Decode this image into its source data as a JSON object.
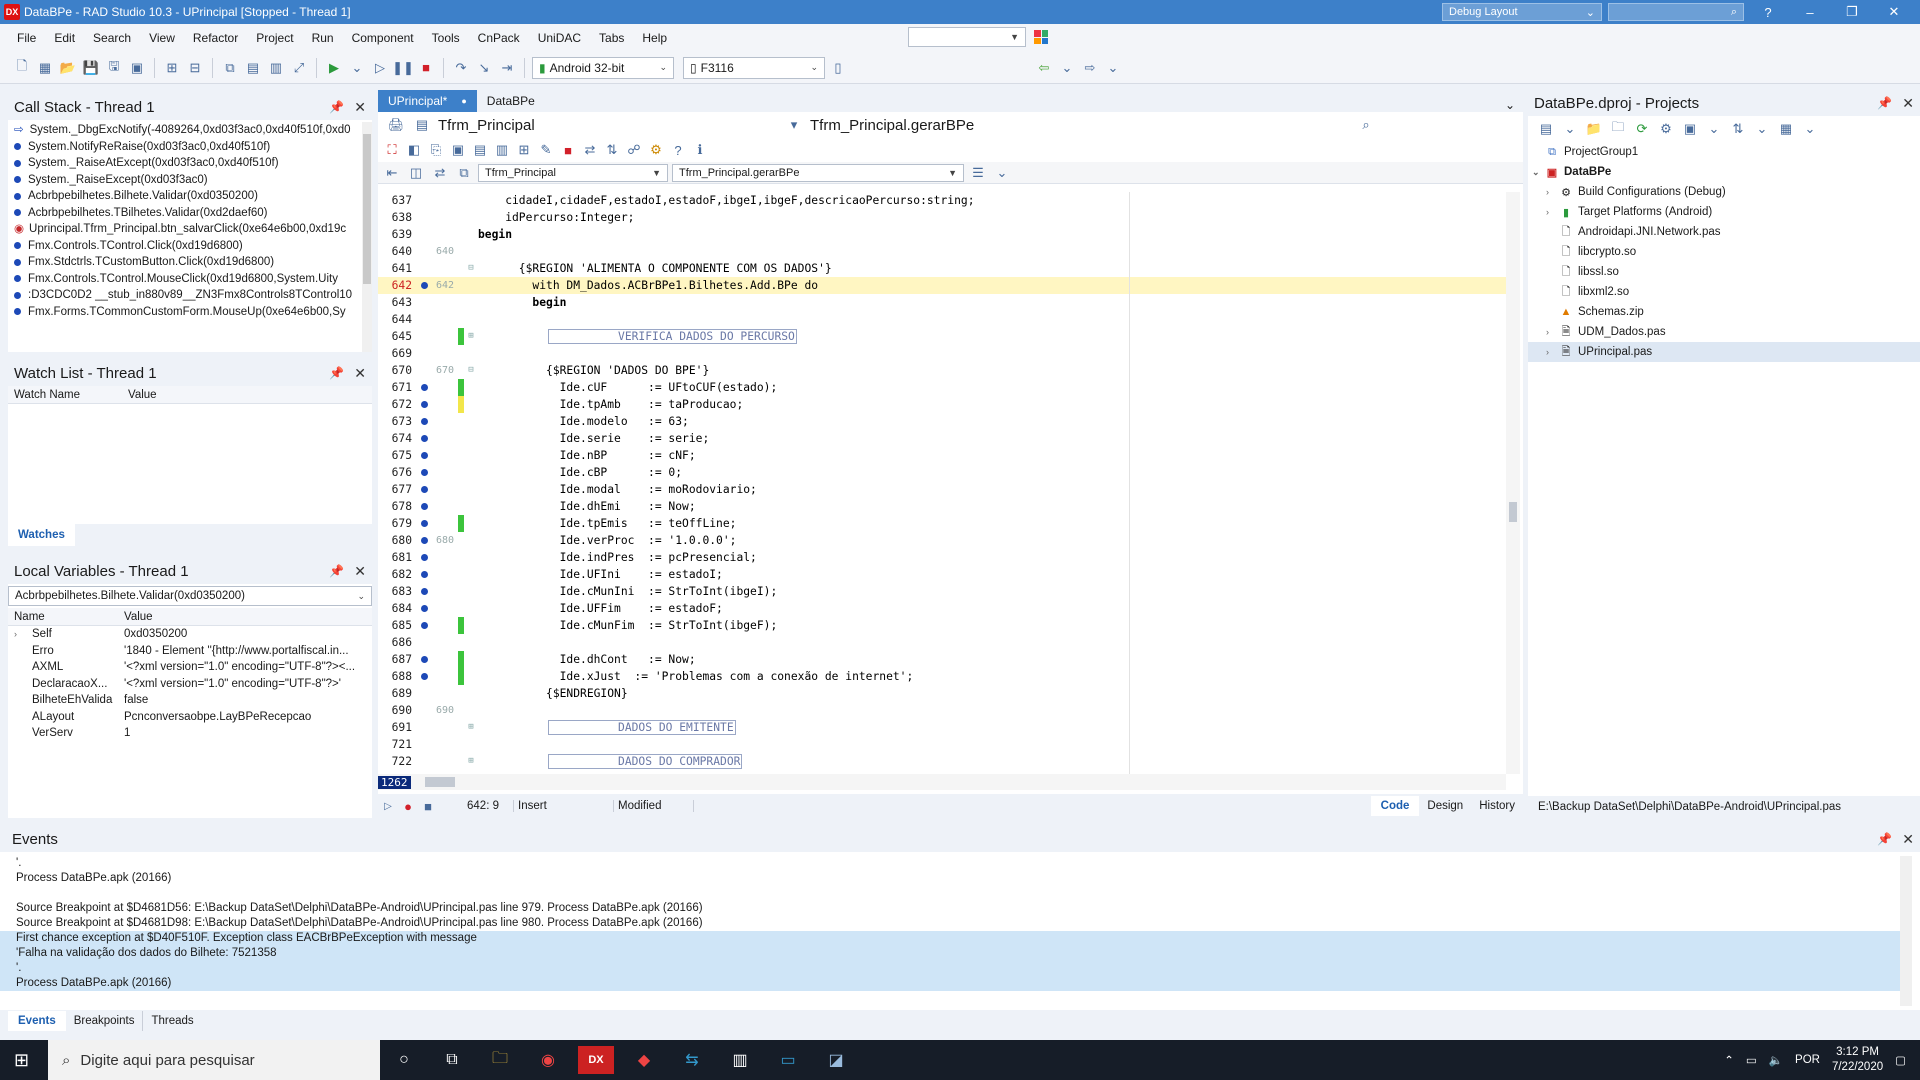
{
  "window": {
    "title": "DataBPe - RAD Studio 10.3 - UPrincipal [Stopped - Thread 1]",
    "layout_combo": "Debug Layout",
    "search_placeholder": ""
  },
  "menu": [
    "File",
    "Edit",
    "Search",
    "View",
    "Refactor",
    "Project",
    "Run",
    "Component",
    "Tools",
    "CnPack",
    "UniDAC",
    "Tabs",
    "Help"
  ],
  "toolbar": {
    "platform": "Android 32-bit",
    "device": "F3116"
  },
  "call_stack": {
    "title": "Call Stack - Thread 1",
    "items": [
      "System._DbgExcNotify(-4089264,0xd03f3ac0,0xd40f510f,0xd0",
      "System.NotifyReRaise(0xd03f3ac0,0xd40f510f)",
      "System._RaiseAtExcept(0xd03f3ac0,0xd40f510f)",
      "System._RaiseExcept(0xd03f3ac0)",
      "Acbrbpebilhetes.Bilhete.Validar(0xd0350200)",
      "Acbrbpebilhetes.TBilhetes.Validar(0xd2daef60)",
      "Uprincipal.Tfrm_Principal.btn_salvarClick(0xe64e6b00,0xd19c",
      "Fmx.Controls.TControl.Click(0xd19d6800)",
      "Fmx.Stdctrls.TCustomButton.Click(0xd19d6800)",
      "Fmx.Controls.TControl.MouseClick(0xd19d6800,System.Uity",
      ":D3CDC0D2 __stub_in880v89__ZN3Fmx8Controls8TControl10",
      "Fmx.Forms.TCommonCustomForm.MouseUp(0xe64e6b00,Sy"
    ]
  },
  "watch_list": {
    "title": "Watch List - Thread 1",
    "col_name": "Watch Name",
    "col_value": "Value",
    "tab": "Watches"
  },
  "locals": {
    "title": "Local Variables - Thread 1",
    "context": "Acbrbpebilhetes.Bilhete.Validar(0xd0350200)",
    "col_name": "Name",
    "col_value": "Value",
    "rows": [
      {
        "name": "Self",
        "value": "0xd0350200"
      },
      {
        "name": "Erro",
        "value": "'1840 - Element ''{http://www.portalfiscal.in..."
      },
      {
        "name": "AXML",
        "value": "'<?xml version=\"1.0\" encoding=\"UTF-8\"?><..."
      },
      {
        "name": "DeclaracaoX...",
        "value": "'<?xml version=\"1.0\" encoding=\"UTF-8\"?>'"
      },
      {
        "name": "BilheteEhValida",
        "value": "false"
      },
      {
        "name": "ALayout",
        "value": "Pcnconversaobpe.LayBPeRecepcao"
      },
      {
        "name": "VerServ",
        "value": "1"
      }
    ]
  },
  "editor": {
    "tabs": [
      "UPrincipal*",
      "DataBPe"
    ],
    "class_combo": "Tfrm_Principal",
    "method_combo": "Tfrm_Principal.gerarBPe",
    "nav_class": "Tfrm_Principal",
    "nav_method": "Tfrm_Principal.gerarBPe",
    "lines": [
      {
        "n": "637",
        "code": "    cidadeI,cidadeF,estadoI,estadoF,ibgeI,ibgeF,descricaoPercurso:string;"
      },
      {
        "n": "638",
        "code": "    idPercurso:Integer;"
      },
      {
        "n": "639",
        "code": "begin"
      },
      {
        "n": "640",
        "code": ""
      },
      {
        "n": "641",
        "code": "      {$REGION 'ALIMENTA O COMPONENTE COM OS DADOS'}"
      },
      {
        "n": "642",
        "code": "        with DM_Dados.ACBrBPe1.Bilhetes.Add.BPe do"
      },
      {
        "n": "643",
        "code": "        begin"
      },
      {
        "n": "644",
        "code": ""
      },
      {
        "n": "645",
        "code": "          VERIFICA DADOS DO PERCURSO"
      },
      {
        "n": "669",
        "code": ""
      },
      {
        "n": "670",
        "code": "          {$REGION 'DADOS DO BPE'}"
      },
      {
        "n": "671",
        "code": "            Ide.cUF      := UFtoCUF(estado);"
      },
      {
        "n": "672",
        "code": "            Ide.tpAmb    := taProducao;"
      },
      {
        "n": "673",
        "code": "            Ide.modelo   := 63;"
      },
      {
        "n": "674",
        "code": "            Ide.serie    := serie;"
      },
      {
        "n": "675",
        "code": "            Ide.nBP      := cNF;"
      },
      {
        "n": "676",
        "code": "            Ide.cBP      := 0;"
      },
      {
        "n": "677",
        "code": "            Ide.modal    := moRodoviario;"
      },
      {
        "n": "678",
        "code": "            Ide.dhEmi    := Now;"
      },
      {
        "n": "679",
        "code": "            Ide.tpEmis   := teOffLine;"
      },
      {
        "n": "680",
        "code": "            Ide.verProc  := '1.0.0.0';"
      },
      {
        "n": "681",
        "code": "            Ide.indPres  := pcPresencial;"
      },
      {
        "n": "682",
        "code": "            Ide.UFIni    := estadoI;"
      },
      {
        "n": "683",
        "code": "            Ide.cMunIni  := StrToInt(ibgeI);"
      },
      {
        "n": "684",
        "code": "            Ide.UFFim    := estadoF;"
      },
      {
        "n": "685",
        "code": "            Ide.cMunFim  := StrToInt(ibgeF);"
      },
      {
        "n": "686",
        "code": ""
      },
      {
        "n": "687",
        "code": "            Ide.dhCont   := Now;"
      },
      {
        "n": "688",
        "code": "            Ide.xJust  := 'Problemas com a conexão de internet';"
      },
      {
        "n": "689",
        "code": "          {$ENDREGION}"
      },
      {
        "n": "690",
        "code": ""
      },
      {
        "n": "691",
        "code": "          DADOS DO EMITENTE"
      },
      {
        "n": "721",
        "code": ""
      },
      {
        "n": "722",
        "code": "          DADOS DO COMPRADOR"
      }
    ],
    "line_box": "1262",
    "status_pos": "642:  9",
    "status_mode": "Insert",
    "status_modified": "Modified",
    "bottom_tabs": [
      "Code",
      "Design",
      "History"
    ]
  },
  "projects": {
    "title": "DataBPe.dproj - Projects",
    "items": [
      {
        "label": "ProjectGroup1",
        "level": 0
      },
      {
        "label": "DataBPe",
        "level": 1
      },
      {
        "label": "Build Configurations (Debug)",
        "level": 2
      },
      {
        "label": "Target Platforms (Android)",
        "level": 2
      },
      {
        "label": "Androidapi.JNI.Network.pas",
        "level": 2
      },
      {
        "label": "libcrypto.so",
        "level": 2
      },
      {
        "label": "libssl.so",
        "level": 2
      },
      {
        "label": "libxml2.so",
        "level": 2
      },
      {
        "label": "Schemas.zip",
        "level": 2
      },
      {
        "label": "UDM_Dados.pas",
        "level": 2
      },
      {
        "label": "UPrincipal.pas",
        "level": 2
      }
    ],
    "path": "E:\\Backup DataSet\\Delphi\\DataBPe-Android\\UPrincipal.pas"
  },
  "events": {
    "title": "Events",
    "lines": [
      "'.",
      "Process DataBPe.apk (20166)",
      "",
      "Source Breakpoint at $D4681D56: E:\\Backup DataSet\\Delphi\\DataBPe-Android\\UPrincipal.pas line 979. Process DataBPe.apk (20166)",
      "Source Breakpoint at $D4681D98: E:\\Backup DataSet\\Delphi\\DataBPe-Android\\UPrincipal.pas line 980. Process DataBPe.apk (20166)",
      "First chance exception at $D40F510F. Exception class EACBrBPeException with message",
      "'Falha na validação dos dados do Bilhete: 7521358",
      "'.",
      "Process DataBPe.apk (20166)"
    ],
    "tabs": [
      "Events",
      "Breakpoints",
      "Threads"
    ]
  },
  "taskbar": {
    "search_placeholder": "Digite aqui para pesquisar",
    "lang": "POR",
    "time": "3:12 PM",
    "date": "7/22/2020"
  }
}
